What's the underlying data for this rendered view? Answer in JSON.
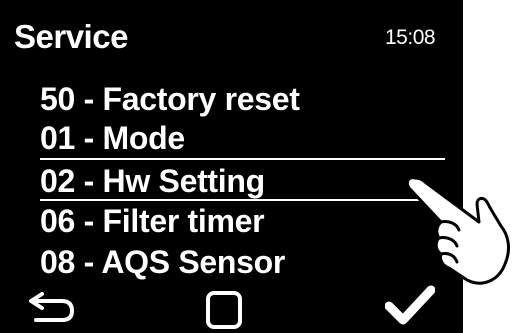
{
  "header": {
    "title": "Service",
    "time": "15:08"
  },
  "menu": {
    "items": [
      {
        "label": "50 - Factory reset",
        "selected": false
      },
      {
        "label": "01 - Mode",
        "selected": false
      },
      {
        "label": "02 - Hw Setting",
        "selected": true
      },
      {
        "label": "06 - Filter timer",
        "selected": false
      },
      {
        "label": "08 - AQS Sensor",
        "selected": false
      }
    ]
  },
  "softkeys": {
    "left_icon": "back-arrow-icon",
    "center_icon": "square-icon",
    "right_icon": "checkmark-icon"
  },
  "colors": {
    "screen_background": "#000000",
    "text": "#ffffff",
    "page_background": "#ffffff"
  },
  "overlay": {
    "icon": "pointing-hand-icon"
  }
}
